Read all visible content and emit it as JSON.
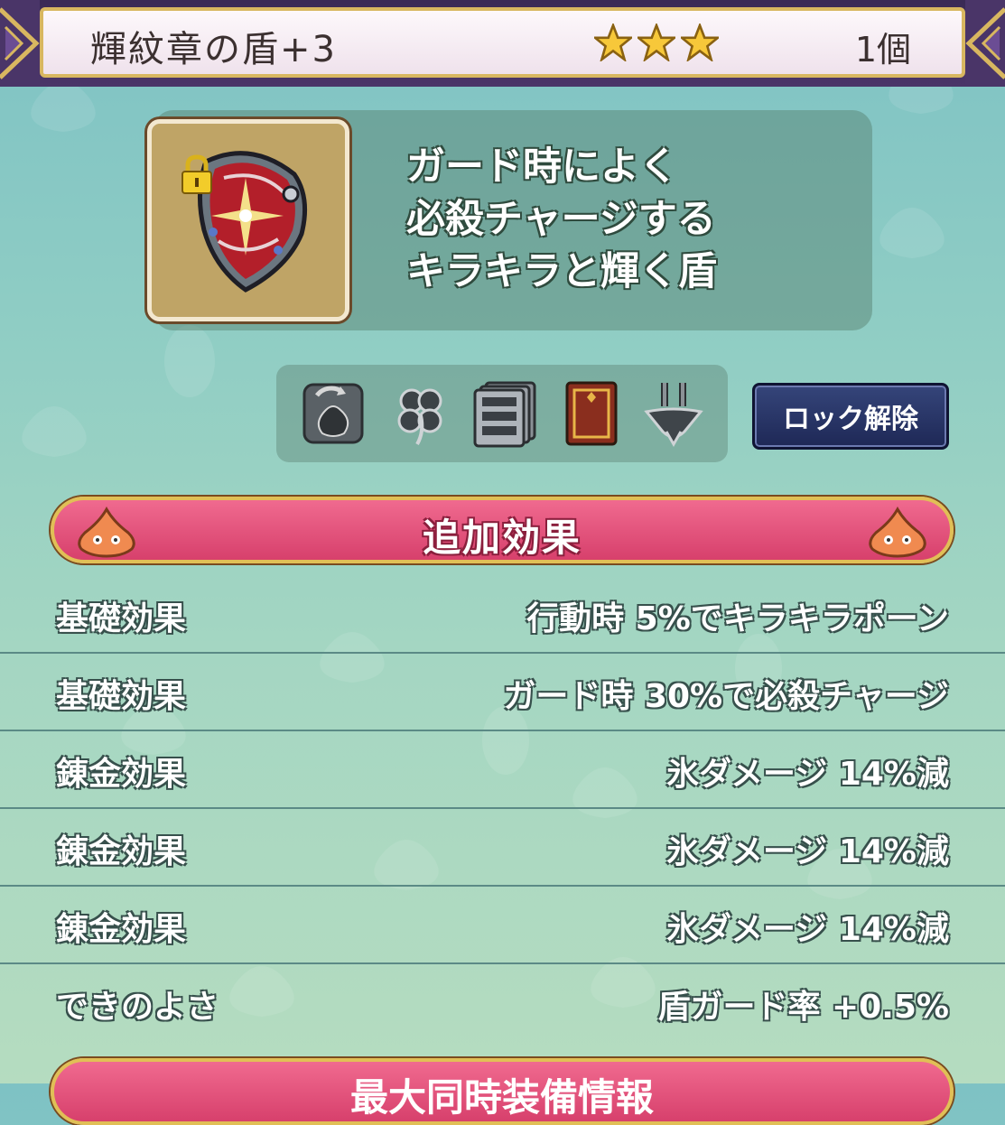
{
  "header": {
    "title": "輝紋章の盾+3",
    "stars": 3,
    "count": "1個"
  },
  "item": {
    "icon": "shield-icon",
    "locked": true,
    "description": [
      "ガード時によく",
      "必殺チャージする",
      "キラキラと輝く盾"
    ]
  },
  "actions": {
    "icons": [
      "exchange-bag-icon",
      "clover-icon",
      "storage-drawers-icon",
      "book-icon",
      "alchemy-pot-icon"
    ],
    "unlock_label": "ロック解除"
  },
  "section": {
    "title": "追加効果"
  },
  "effects": [
    {
      "label": "基礎効果",
      "value": "行動時 5%でキラキラポーン"
    },
    {
      "label": "基礎効果",
      "value": "ガード時 30%で必殺チャージ"
    },
    {
      "label": "錬金効果",
      "value": "氷ダメージ 14%減"
    },
    {
      "label": "錬金効果",
      "value": "氷ダメージ 14%減"
    },
    {
      "label": "錬金効果",
      "value": "氷ダメージ 14%減"
    },
    {
      "label": "できのよさ",
      "value": "盾ガード率 +0.5%"
    }
  ],
  "next_section": {
    "title": "最大同時装備情報"
  },
  "colors": {
    "accent_pink": "#d7406c",
    "gold_border": "#e1bf56",
    "button_navy": "#1e2856",
    "background_teal": "#8fcdc4"
  }
}
